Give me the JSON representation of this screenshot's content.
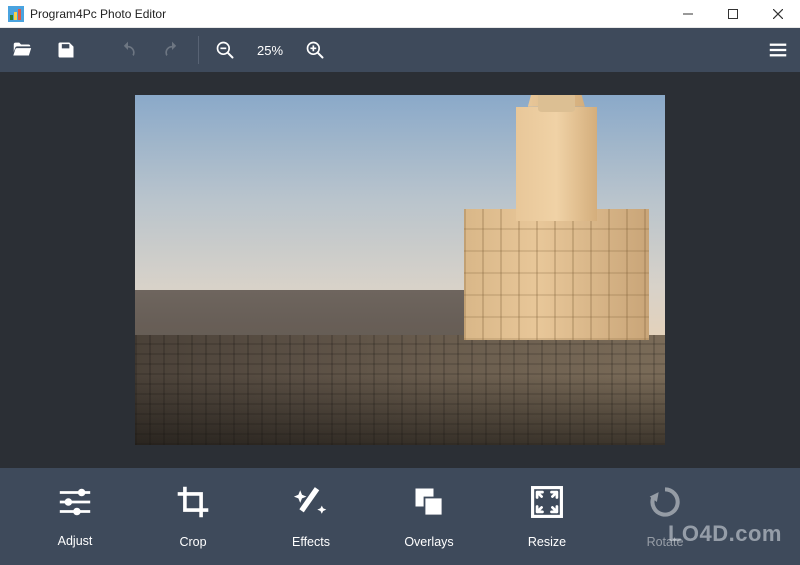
{
  "window": {
    "title": "Program4Pc Photo Editor",
    "icons": {
      "app": "app-icon",
      "minimize": "minimize",
      "maximize": "maximize",
      "close": "close"
    }
  },
  "toolbar": {
    "open": "open-icon",
    "save": "save-icon",
    "undo": "undo-icon",
    "redo": "redo-icon",
    "zoom_out": "zoom-out-icon",
    "zoom_label": "25%",
    "zoom_in": "zoom-in-icon",
    "menu": "hamburger-icon"
  },
  "canvas": {
    "description": "cityscape photo with ornate sunlit tower on right, rooftops in foreground, soft dusk sky"
  },
  "actions": [
    {
      "id": "adjust",
      "label": "Adjust",
      "icon": "sliders-icon",
      "enabled": true
    },
    {
      "id": "crop",
      "label": "Crop",
      "icon": "crop-icon",
      "enabled": true
    },
    {
      "id": "effects",
      "label": "Effects",
      "icon": "wand-icon",
      "enabled": true
    },
    {
      "id": "overlays",
      "label": "Overlays",
      "icon": "overlays-icon",
      "enabled": true
    },
    {
      "id": "resize",
      "label": "Resize",
      "icon": "resize-icon",
      "enabled": true
    },
    {
      "id": "rotate",
      "label": "Rotate",
      "icon": "rotate-icon",
      "enabled": false
    }
  ],
  "watermark": "LO4D.com"
}
